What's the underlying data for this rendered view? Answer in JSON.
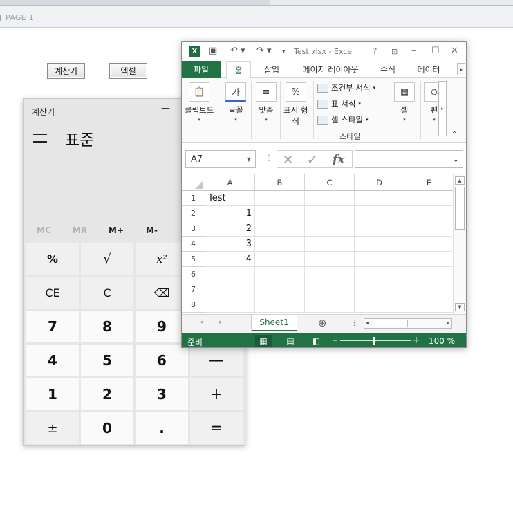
{
  "page": {
    "tab_label": "PAGE 1",
    "buttons": {
      "calc": "계산기",
      "excel": "엑셀"
    }
  },
  "calculator": {
    "title": "계산기",
    "minimize": "—",
    "mode": "표준",
    "memory": [
      "MC",
      "MR",
      "M+",
      "M-"
    ],
    "keys": [
      [
        "%",
        "√",
        "x²",
        ""
      ],
      [
        "CE",
        "C",
        "⌫",
        ""
      ],
      [
        "7",
        "8",
        "9",
        ""
      ],
      [
        "4",
        "5",
        "6",
        "—"
      ],
      [
        "1",
        "2",
        "3",
        "+"
      ],
      [
        "±",
        "0",
        ".",
        "="
      ]
    ]
  },
  "excel": {
    "filename": "Test.xlsx - Excel",
    "help": "?",
    "tabs": [
      "파일",
      "홈",
      "삽입",
      "페이지 레이아웃",
      "수식",
      "데이터"
    ],
    "ribbon": {
      "clipboard": "클립보드",
      "font": "글꼴",
      "alignment": "맞춤",
      "number_line1": "표시 형",
      "number_line2": "식",
      "cond_format": "조건부 서식",
      "table_format": "표 서식",
      "cell_styles": "셀 스타일",
      "styles_group": "스타일",
      "cells": "셀",
      "editing": "편",
      "font_icon": "가",
      "percent_icon": "%"
    },
    "name_box": "A7",
    "columns": [
      "A",
      "B",
      "C",
      "D",
      "E"
    ],
    "rows": [
      [
        "1",
        "Test"
      ],
      [
        "2",
        "1"
      ],
      [
        "3",
        "2"
      ],
      [
        "4",
        "3"
      ],
      [
        "5",
        "4"
      ],
      [
        "6",
        ""
      ],
      [
        "7",
        ""
      ],
      [
        "8",
        ""
      ]
    ],
    "sheet": "Sheet1",
    "status": "준비",
    "zoom": "100 %"
  }
}
